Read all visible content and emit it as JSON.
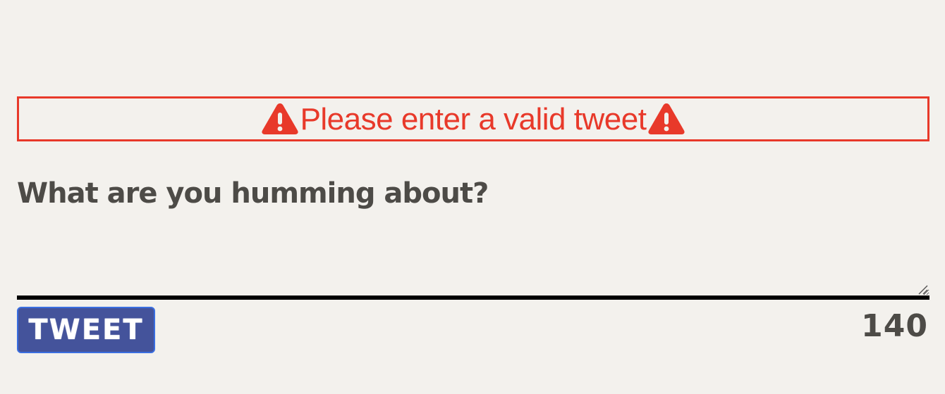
{
  "error": {
    "message": "Please enter a valid tweet",
    "icon_left": "warning-icon",
    "icon_right": "warning-icon",
    "color": "#e8392a"
  },
  "composer": {
    "prompt": "What are you humming about?",
    "value": "",
    "remaining_chars": "140"
  },
  "actions": {
    "tweet_label": "TWEET",
    "tweet_color": "#44539b"
  },
  "colors": {
    "background": "#f3f1ed",
    "text": "#4d4b47"
  }
}
